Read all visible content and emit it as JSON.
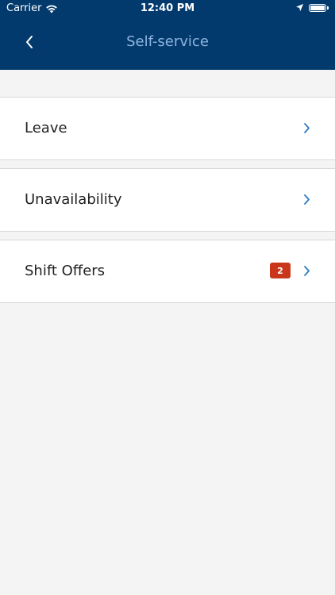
{
  "status_bar": {
    "carrier": "Carrier",
    "time": "12:40 PM"
  },
  "header": {
    "title": "Self-service"
  },
  "items": [
    {
      "label": "Leave",
      "badge": ""
    },
    {
      "label": "Unavailability",
      "badge": ""
    },
    {
      "label": "Shift Offers",
      "badge": "2"
    }
  ],
  "colors": {
    "header_bg": "#033a6d",
    "title": "#8fb4e0",
    "chevron": "#2a7bc0",
    "badge": "#c9361a"
  }
}
